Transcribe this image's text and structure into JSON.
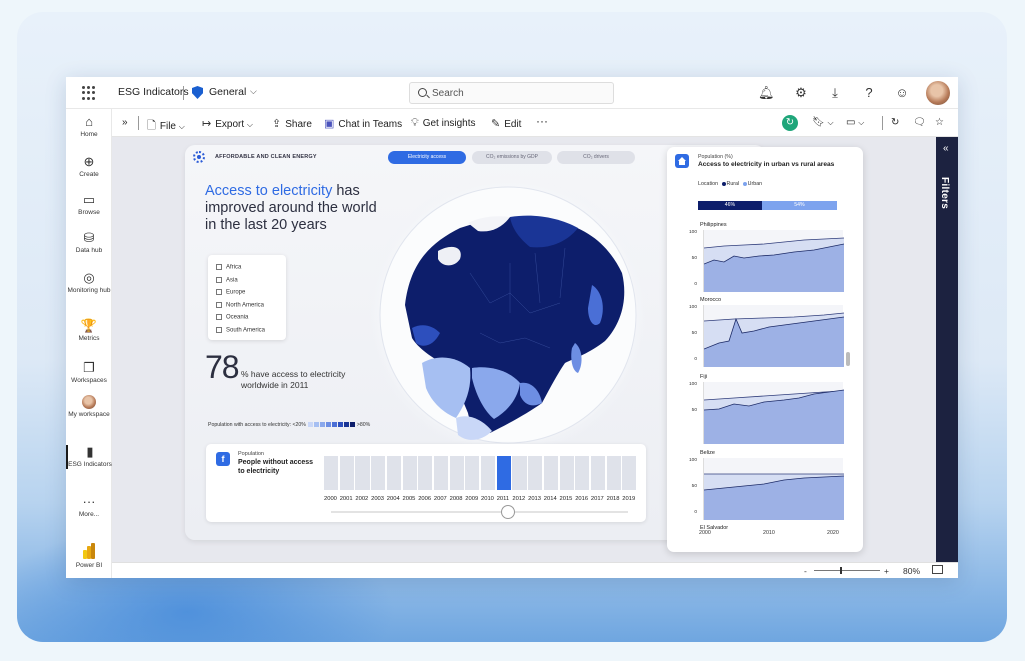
{
  "workspace": "ESG Indicators",
  "section": "General",
  "search_placeholder": "Search",
  "nav": [
    {
      "label": "Home",
      "icon": "home-icon",
      "glyph": "⌂"
    },
    {
      "label": "Create",
      "icon": "create-icon",
      "glyph": "⊕"
    },
    {
      "label": "Browse",
      "icon": "browse-icon",
      "glyph": "▭"
    },
    {
      "label": "Data hub",
      "icon": "data-hub-icon",
      "glyph": "⛁"
    },
    {
      "label": "Monitoring hub",
      "icon": "monitoring-icon",
      "glyph": "◎"
    },
    {
      "label": "Metrics",
      "icon": "metrics-icon",
      "glyph": "🏆"
    },
    {
      "label": "Workspaces",
      "icon": "workspaces-icon",
      "glyph": "❐"
    },
    {
      "label": "My workspace",
      "icon": "my-workspace-avatar",
      "glyph": ""
    },
    {
      "label": "ESG Indicators",
      "icon": "esg-report-icon",
      "glyph": "▮"
    },
    {
      "label": "More...",
      "icon": "more-icon",
      "glyph": "···"
    },
    {
      "label": "Power BI",
      "icon": "power-bi-logo",
      "glyph": ""
    }
  ],
  "toolbar": {
    "file": "File",
    "export": "Export",
    "share": "Share",
    "chat": "Chat in Teams",
    "insights": "Get insights",
    "edit": "Edit",
    "more": "···"
  },
  "filters_label": "Filters",
  "report": {
    "category": "AFFORDABLE AND CLEAN ENERGY",
    "tabs": [
      "Electricity access",
      "CO₂ emissions by GDP",
      "CO₂ drivers"
    ],
    "headline_highlight": "Access to electricity",
    "headline_rest": " has improved around the world in the last 20 years",
    "regions": [
      "Africa",
      "Asia",
      "Europe",
      "North America",
      "Oceania",
      "South America"
    ],
    "big_number": "78",
    "big_text": "% have access to electricity worldwide in 2011",
    "scale_label": "Population with access to electricity:",
    "scale_min": "<20%",
    "scale_max": ">80%",
    "scale_colors": [
      "#c9d7f7",
      "#a6bff2",
      "#8aa8ec",
      "#6d8ee3",
      "#4a6fd6",
      "#2d4fbd",
      "#1a3596",
      "#0d1e6b"
    ],
    "bottom_card": {
      "label": "Population",
      "title": "People without access to electricity"
    },
    "years": [
      "2000",
      "2001",
      "2002",
      "2003",
      "2004",
      "2005",
      "2006",
      "2007",
      "2008",
      "2009",
      "2010",
      "2011",
      "2012",
      "2013",
      "2014",
      "2015",
      "2016",
      "2017",
      "2018",
      "2019"
    ],
    "selected_year": "2011"
  },
  "right_card": {
    "subtitle": "Population (%)",
    "title": "Access to electricity in urban vs rural areas",
    "location_label": "Location",
    "rural_label": "Rural",
    "urban_label": "Urban",
    "rural_pct_label": "46%",
    "urban_pct_label": "54%",
    "rural_fraction": 0.46,
    "rural_color": "#0d1e6b",
    "urban_color": "#7da3ee",
    "countries": [
      {
        "name": "Philippines",
        "yticks": [
          "100",
          "50",
          "0"
        ]
      },
      {
        "name": "Morocco",
        "yticks": [
          "100",
          "50",
          "0"
        ]
      },
      {
        "name": "Fiji",
        "yticks": [
          "100",
          "50"
        ]
      },
      {
        "name": "Belize",
        "yticks": [
          "100",
          "50",
          "0"
        ]
      },
      {
        "name": "El Salvador",
        "yticks": []
      }
    ],
    "x_ticks": [
      "2000",
      "2010",
      "2020"
    ]
  },
  "status": {
    "zoom": "80%",
    "minus": "-",
    "plus": "+"
  }
}
